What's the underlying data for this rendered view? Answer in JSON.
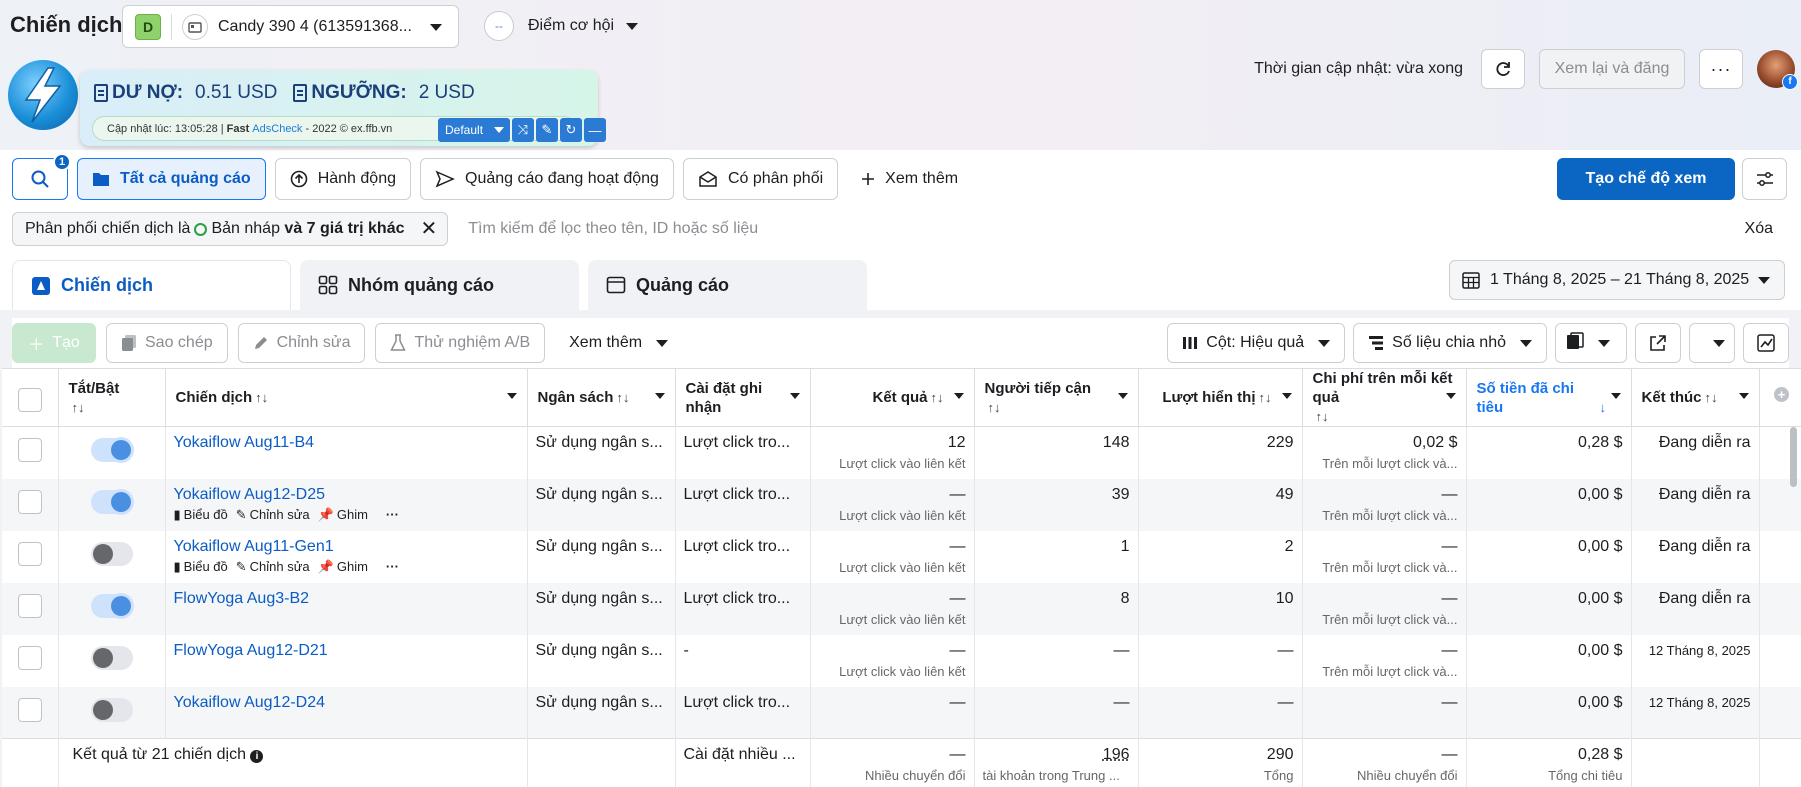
{
  "header": {
    "title": "Chiến dịch",
    "account": {
      "badge": "D",
      "name": "Candy 390 4 (613591368..."
    },
    "opportunity": {
      "icon_text": "--",
      "label": "Điểm cơ hội"
    },
    "update_text": "Thời gian cập nhật: vừa xong",
    "review_label": "Xem lại và đăng"
  },
  "debt_widget": {
    "debt_label": "DƯ NỢ:",
    "debt_value": "0.51 USD",
    "threshold_label": "NGƯỠNG:",
    "threshold_value": "2 USD",
    "updated_prefix": "Cập nhật lúc: 13:05:28 |",
    "brand_fast": "Fast",
    "brand_name": "AdsCheck",
    "brand_suffix": "- 2022 © ex.ffb.vn",
    "preset": "Default"
  },
  "filters": {
    "search_badge": "1",
    "items": [
      "Tất cả quảng cáo",
      "Hành động",
      "Quảng cáo đang hoạt động",
      "Có phân phối",
      "Xem thêm"
    ],
    "create_view": "Tạo chế độ xem"
  },
  "chip": {
    "text_prefix": "Phân phối chiến dịch là",
    "text_value": "Bản nháp",
    "text_suffix": "và 7 giá trị khác",
    "search_placeholder": "Tìm kiếm để lọc theo tên, ID hoặc số liệu",
    "clear": "Xóa"
  },
  "tabs": [
    "Chiến dịch",
    "Nhóm quảng cáo",
    "Quảng cáo"
  ],
  "date_range": "1 Tháng 8, 2025 – 21 Tháng 8, 2025",
  "toolbar": {
    "create": "Tạo",
    "copy": "Sao chép",
    "edit": "Chỉnh sửa",
    "abtest": "Thử nghiệm A/B",
    "more": "Xem thêm",
    "columns": "Cột: Hiệu quả",
    "breakdown": "Số liệu chia nhỏ"
  },
  "table": {
    "headers": {
      "toggle": "Tắt/Bật",
      "campaign": "Chiến dịch",
      "budget": "Ngân sách",
      "attribution": "Cài đặt ghi nhận",
      "results": "Kết quả",
      "reach": "Người tiếp cận",
      "impressions": "Lượt hiển thị",
      "cost_per_result": "Chi phí trên mỗi kết quả",
      "spent": "Số tiền đã chi tiêu",
      "end": "Kết thúc"
    },
    "row_tools": {
      "chart": "Biểu đồ",
      "edit": "Chỉnh sửa",
      "pin": "Ghim"
    },
    "rows": [
      {
        "name": "Yokaiflow Aug11-B4",
        "on": true,
        "budget": "Sử dụng ngân s...",
        "attribution": "Lượt click tro...",
        "results": "12",
        "results_sub": "Lượt click vào liên kết",
        "reach": "148",
        "impressions": "229",
        "cpr": "0,02 $",
        "cpr_sub": "Trên mỗi lượt click và...",
        "spent": "0,28 $",
        "end": "Đang diễn ra",
        "tools": false
      },
      {
        "name": "Yokaiflow Aug12-D25",
        "on": true,
        "budget": "Sử dụng ngân s...",
        "attribution": "Lượt click tro...",
        "results": "—",
        "results_sub": "Lượt click vào liên kết",
        "reach": "39",
        "impressions": "49",
        "cpr": "—",
        "cpr_sub": "Trên mỗi lượt click và...",
        "spent": "0,00 $",
        "end": "Đang diễn ra",
        "tools": true
      },
      {
        "name": "Yokaiflow Aug11-Gen1",
        "on": false,
        "budget": "Sử dụng ngân s...",
        "attribution": "Lượt click tro...",
        "results": "—",
        "results_sub": "Lượt click vào liên kết",
        "reach": "1",
        "impressions": "2",
        "cpr": "—",
        "cpr_sub": "Trên mỗi lượt click và...",
        "spent": "0,00 $",
        "end": "Đang diễn ra",
        "tools": true
      },
      {
        "name": "FlowYoga Aug3-B2",
        "on": true,
        "budget": "Sử dụng ngân s...",
        "attribution": "Lượt click tro...",
        "results": "—",
        "results_sub": "Lượt click vào liên kết",
        "reach": "8",
        "impressions": "10",
        "cpr": "—",
        "cpr_sub": "Trên mỗi lượt click và...",
        "spent": "0,00 $",
        "end": "Đang diễn ra",
        "tools": false
      },
      {
        "name": "FlowYoga Aug12-D21",
        "on": false,
        "budget": "Sử dụng ngân s...",
        "attribution": "-",
        "results": "—",
        "results_sub": "Lượt click vào liên kết",
        "reach": "—",
        "impressions": "—",
        "cpr": "—",
        "cpr_sub": "Trên mỗi lượt click và...",
        "spent": "0,00 $",
        "end": "12 Tháng 8, 2025",
        "tools": false
      },
      {
        "name": "Yokaiflow Aug12-D24",
        "on": false,
        "budget": "Sử dụng ngân s...",
        "attribution": "Lượt click tro...",
        "results": "—",
        "results_sub": "",
        "reach": "—",
        "impressions": "—",
        "cpr": "—",
        "cpr_sub": "",
        "spent": "0,00 $",
        "end": "12 Tháng 8, 2025",
        "tools": false
      }
    ],
    "footer": {
      "label": "Kết quả từ 21 chiến dịch",
      "attribution": "Cài đặt nhiều ...",
      "results": "—",
      "results_sub": "Nhiều chuyển đổi",
      "reach": "196",
      "reach_sub": "tài khoản trong Trung ...",
      "impressions": "290",
      "impressions_sub": "Tổng",
      "cpr": "—",
      "cpr_sub": "Nhiều chuyển đổi",
      "spent": "0,28 $",
      "spent_sub": "Tổng chi tiêu"
    }
  }
}
